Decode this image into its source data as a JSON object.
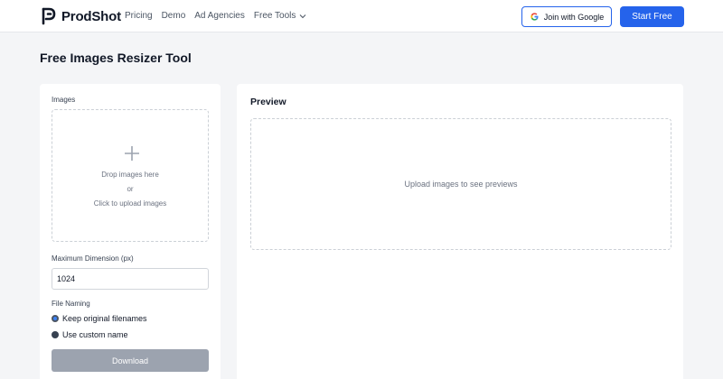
{
  "header": {
    "brand": "ProdShot",
    "nav": [
      "Pricing",
      "Demo",
      "Ad Agencies",
      "Free Tools"
    ],
    "google_button": "Join with Google",
    "start_button": "Start Free"
  },
  "page": {
    "title": "Free Images Resizer Tool"
  },
  "form": {
    "images_label": "Images",
    "drop_line1": "Drop images here",
    "drop_line2": "or",
    "drop_line3": "Click to upload images",
    "max_dim_label": "Maximum Dimension (px)",
    "max_dim_value": "1024",
    "file_naming_label": "File Naming",
    "options": [
      "Keep original filenames",
      "Use custom name"
    ],
    "selected_option": "Keep original filenames",
    "download_label": "Download"
  },
  "preview": {
    "title": "Preview",
    "empty_text": "Upload images to see previews"
  },
  "colors": {
    "accent": "#2563eb",
    "page_bg": "#f4f5f7",
    "disabled_button": "#9ca3af"
  },
  "icons": [
    "prodshot-logo-icon",
    "chevron-down-icon",
    "google-icon",
    "plus-icon"
  ]
}
